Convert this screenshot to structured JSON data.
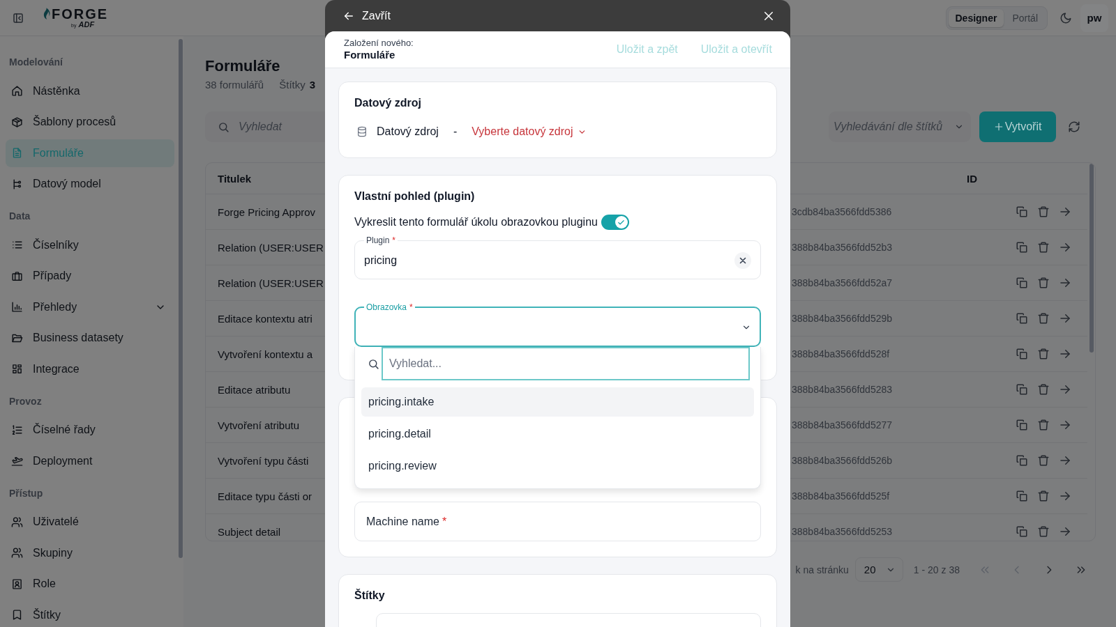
{
  "header": {
    "logo": {
      "name": "FORGE",
      "by": "by",
      "brand": "ADF"
    },
    "modes": [
      {
        "label": "Designer",
        "selected": true
      },
      {
        "label": "Portál",
        "selected": false
      }
    ],
    "user": "pw"
  },
  "sidebar": {
    "sections": [
      {
        "title": "Modelování",
        "items": [
          {
            "label": "Nástěnka",
            "kind": "link",
            "selected": false
          },
          {
            "label": "Šablony procesů",
            "kind": "link",
            "selected": false
          },
          {
            "label": "Formuláře",
            "kind": "link",
            "selected": true
          },
          {
            "label": "Datový model",
            "kind": "link",
            "selected": false
          }
        ]
      },
      {
        "title": "Data",
        "items": [
          {
            "label": "Číselníky",
            "kind": "link",
            "selected": false
          },
          {
            "label": "Případy",
            "kind": "link",
            "selected": false
          },
          {
            "label": "Přehledy",
            "kind": "group",
            "selected": false,
            "expanded": false
          },
          {
            "label": "Business datasety",
            "kind": "link",
            "selected": false
          },
          {
            "label": "Integrace",
            "kind": "link",
            "selected": false
          }
        ]
      },
      {
        "title": "Provoz",
        "items": [
          {
            "label": "Číselné řady",
            "kind": "link",
            "selected": false
          },
          {
            "label": "Deployment",
            "kind": "link",
            "selected": false
          }
        ]
      },
      {
        "title": "Přístup",
        "items": [
          {
            "label": "Uživatelé",
            "kind": "link",
            "selected": false
          },
          {
            "label": "Skupiny",
            "kind": "link",
            "selected": false
          },
          {
            "label": "Role",
            "kind": "link",
            "selected": false
          },
          {
            "label": "Štítky",
            "kind": "link",
            "selected": false
          }
        ]
      }
    ]
  },
  "page": {
    "title": "Formuláře",
    "count": "38 formulářů",
    "tags_label": "Štítky",
    "tags_count": "3",
    "search": {
      "placeholder": "Vyhledat"
    },
    "tag_filter": {
      "placeholder": "Vyhledávání dle štítků"
    },
    "create_button": {
      "label": "Vytvořit"
    },
    "table": {
      "columns": [
        "Titulek",
        "ID"
      ],
      "rows": [
        {
          "title": "Forge Pricing Approv",
          "id": "3cdb84ba3566fdd5386"
        },
        {
          "title": "Relation (USER:USER",
          "id": "388b84ba3566fdd52b3"
        },
        {
          "title": "Relation (USER:USER",
          "id": "388b84ba3566fdd52a7"
        },
        {
          "title": "Editace kontextu atri",
          "id": "388b84ba3566fdd529b"
        },
        {
          "title": "Vytvoření kontextu a",
          "id": "388b84ba3566fdd528f"
        },
        {
          "title": "Editace atributu",
          "id": "388b84ba3566fdd5283"
        },
        {
          "title": "Vytvoření atributu",
          "id": "388b84ba3566fdd5277"
        },
        {
          "title": "Vytvoření typu části",
          "id": "388b84ba3566fdd526b"
        },
        {
          "title": "Editace typu části or",
          "id": "388b84ba3566fdd525f"
        },
        {
          "title": "Subject detail",
          "id": "388b84ba3566fdd5253"
        }
      ]
    },
    "pagination": {
      "per_page_label": "k na stránku",
      "per_page": "20",
      "range": "1 - 20 z 38",
      "nav": [
        {
          "kind": "first",
          "disabled": true
        },
        {
          "kind": "prev",
          "disabled": true
        },
        {
          "kind": "next",
          "disabled": false
        },
        {
          "kind": "last",
          "disabled": false
        }
      ]
    }
  },
  "modal": {
    "back": "Zavřít",
    "caption": "Založení nového:",
    "title": "Formuláře",
    "actions": [
      {
        "label": "Uložit a zpět",
        "disabled": true
      },
      {
        "label": "Uložit a otevřít",
        "disabled": true
      }
    ],
    "cards": [
      {
        "kind": "datasource",
        "title": "Datový zdroj",
        "label": "Datový zdroj",
        "separator": "-",
        "picker": "Vyberte datový zdroj"
      },
      {
        "kind": "plugin",
        "title": "Vlastní pohled (plugin)",
        "toggle": {
          "label": "Vykreslit tento formulář úkolu obrazovkou pluginu",
          "on": true
        },
        "fields": [
          {
            "kind": "text",
            "label": "Plugin",
            "required_mark": "*",
            "value": "pricing",
            "focused": false
          },
          {
            "kind": "select",
            "label": "Obrazovka",
            "required_mark": "*",
            "focused": true,
            "open": true,
            "search_placeholder": "Vyhledat...",
            "options": [
              {
                "label": "pricing.intake",
                "highlighted": true
              },
              {
                "label": "pricing.detail",
                "highlighted": false
              },
              {
                "label": "pricing.review",
                "highlighted": false
              }
            ]
          }
        ]
      },
      {
        "kind": "fields",
        "fields": [
          {
            "kind": "text",
            "label": "Machine name",
            "required_mark": "*",
            "focused": false
          }
        ]
      },
      {
        "kind": "tags",
        "title": "Štítky"
      }
    ]
  }
}
